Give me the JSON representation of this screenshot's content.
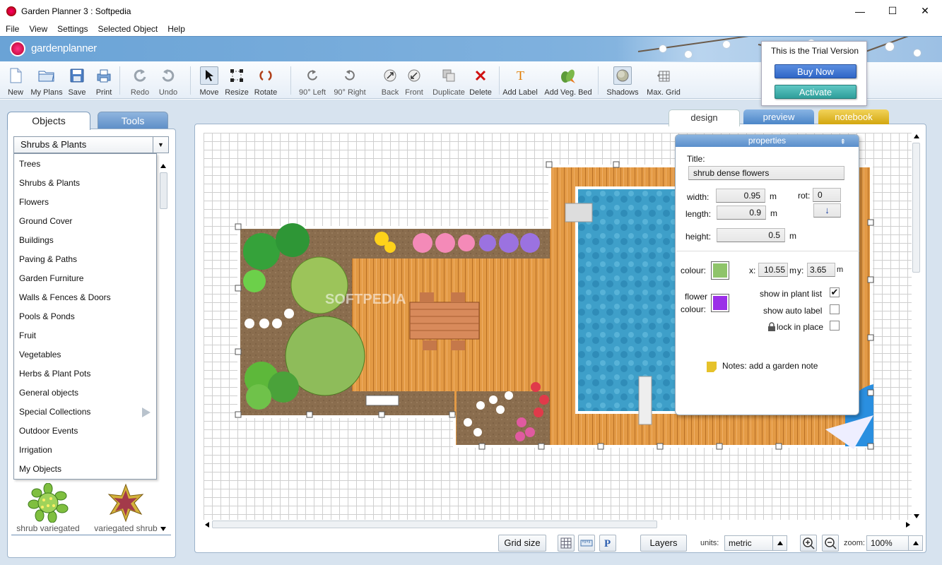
{
  "window": {
    "title": "Garden Planner 3 : Softpedia",
    "controls": [
      "—",
      "☐",
      "✕"
    ]
  },
  "menu": [
    "File",
    "View",
    "Settings",
    "Selected Object",
    "Help"
  ],
  "brand": "gardenplanner",
  "toolbar": {
    "new": "New",
    "my_plans": "My Plans",
    "save": "Save",
    "print": "Print",
    "redo": "Redo",
    "undo": "Undo",
    "move": "Move",
    "resize": "Resize",
    "rotate": "Rotate",
    "rot_left": "90° Left",
    "rot_right": "90° Right",
    "back": "Back",
    "front": "Front",
    "duplicate": "Duplicate",
    "delete": "Delete",
    "add_label": "Add Label",
    "add_veg_bed": "Add Veg. Bed",
    "shadows": "Shadows",
    "max_grid": "Max. Grid"
  },
  "trial": {
    "message": "This is the Trial Version",
    "buy": "Buy Now",
    "activate": "Activate"
  },
  "left": {
    "tab_objects": "Objects",
    "tab_tools": "Tools",
    "category": "Shrubs & Plants",
    "categories": [
      "Trees",
      "Shrubs & Plants",
      "Flowers",
      "Ground Cover",
      "Buildings",
      "Paving & Paths",
      "Garden Furniture",
      "Walls & Fences & Doors",
      "Pools & Ponds",
      "Fruit",
      "Vegetables",
      "Herbs & Plant Pots",
      "General objects",
      "Special Collections",
      "Outdoor Events",
      "Irrigation",
      "My Objects"
    ],
    "thumb1": "shrub variegated",
    "thumb2": "variegated shrub"
  },
  "view_tabs": {
    "design": "design",
    "preview": "preview",
    "notebook": "notebook"
  },
  "properties": {
    "header": "properties",
    "title_label": "Title:",
    "title_value": "shrub dense flowers",
    "width_label": "width:",
    "width_value": "0.95",
    "width_unit": "m",
    "length_label": "length:",
    "length_value": "0.9",
    "length_unit": "m",
    "height_label": "height:",
    "height_value": "0.5",
    "height_unit": "m",
    "rot_label": "rot:",
    "rot_value": "0",
    "colour_label": "colour:",
    "flower_colour_label_1": "flower",
    "flower_colour_label_2": "colour:",
    "x_label": "x:",
    "x_value": "10.55",
    "x_unit": "m",
    "y_label": "y:",
    "y_value": "3.65",
    "y_unit": "m",
    "show_in_plant_list": "show in plant list",
    "show_auto_label": "show auto label",
    "lock_in_place": "lock in place",
    "notes": "Notes: add a garden note",
    "colour": "#8fc46a",
    "flower_colour": "#9b2fe8",
    "show_in_plant_list_checked": true,
    "show_auto_label_checked": false,
    "lock_in_place_checked": false
  },
  "bottom": {
    "grid_size": "Grid size",
    "layers": "Layers",
    "units_label": "units:",
    "units_value": "metric",
    "zoom_label": "zoom:",
    "zoom_value": "100%"
  },
  "watermark": "SOFTPEDIA"
}
